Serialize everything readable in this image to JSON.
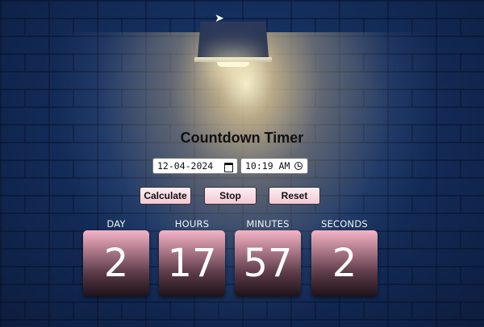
{
  "title": "Countdown Timer",
  "inputs": {
    "date_value": "12-04-2024",
    "time_value": "10:19 AM",
    "date_icon": "calendar-icon",
    "time_icon": "clock-icon"
  },
  "buttons": {
    "calculate": "Calculate",
    "stop": "Stop",
    "reset": "Reset"
  },
  "countdown": [
    {
      "label": "DAY",
      "value": "2"
    },
    {
      "label": "HOURS",
      "value": "17"
    },
    {
      "label": "MINUTES",
      "value": "57"
    },
    {
      "label": "SECONDS",
      "value": "2"
    }
  ],
  "colors": {
    "button_bg": "#f3c8d4",
    "card_top": "#f4b4c6",
    "card_bottom": "#1d1218",
    "wall": "#15305f"
  }
}
